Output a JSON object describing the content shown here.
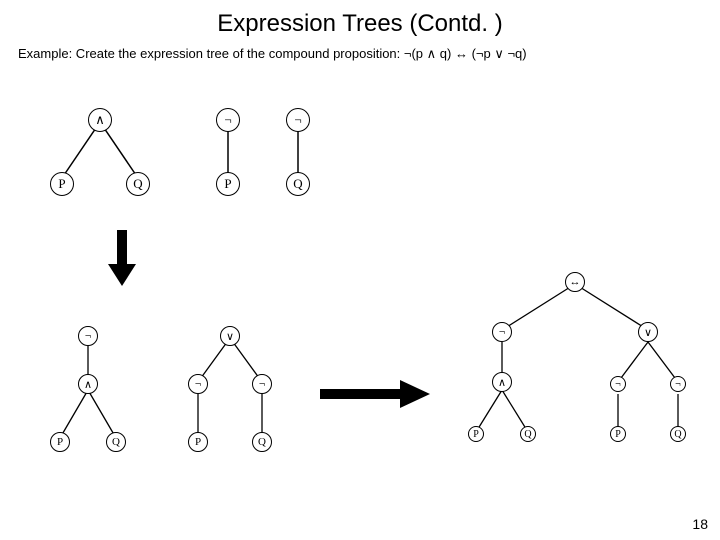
{
  "title": "Expression Trees (Contd. )",
  "subtitle_prefix": "Example: Create the expression tree of the compound proposition: ",
  "expression": "¬(p ∧ q) ↔ (¬p ∨ ¬q)",
  "symbols": {
    "not": "¬",
    "and": "∧",
    "or": "∨",
    "iff": "↔",
    "p": "P",
    "q": "Q"
  },
  "page_number": "18"
}
